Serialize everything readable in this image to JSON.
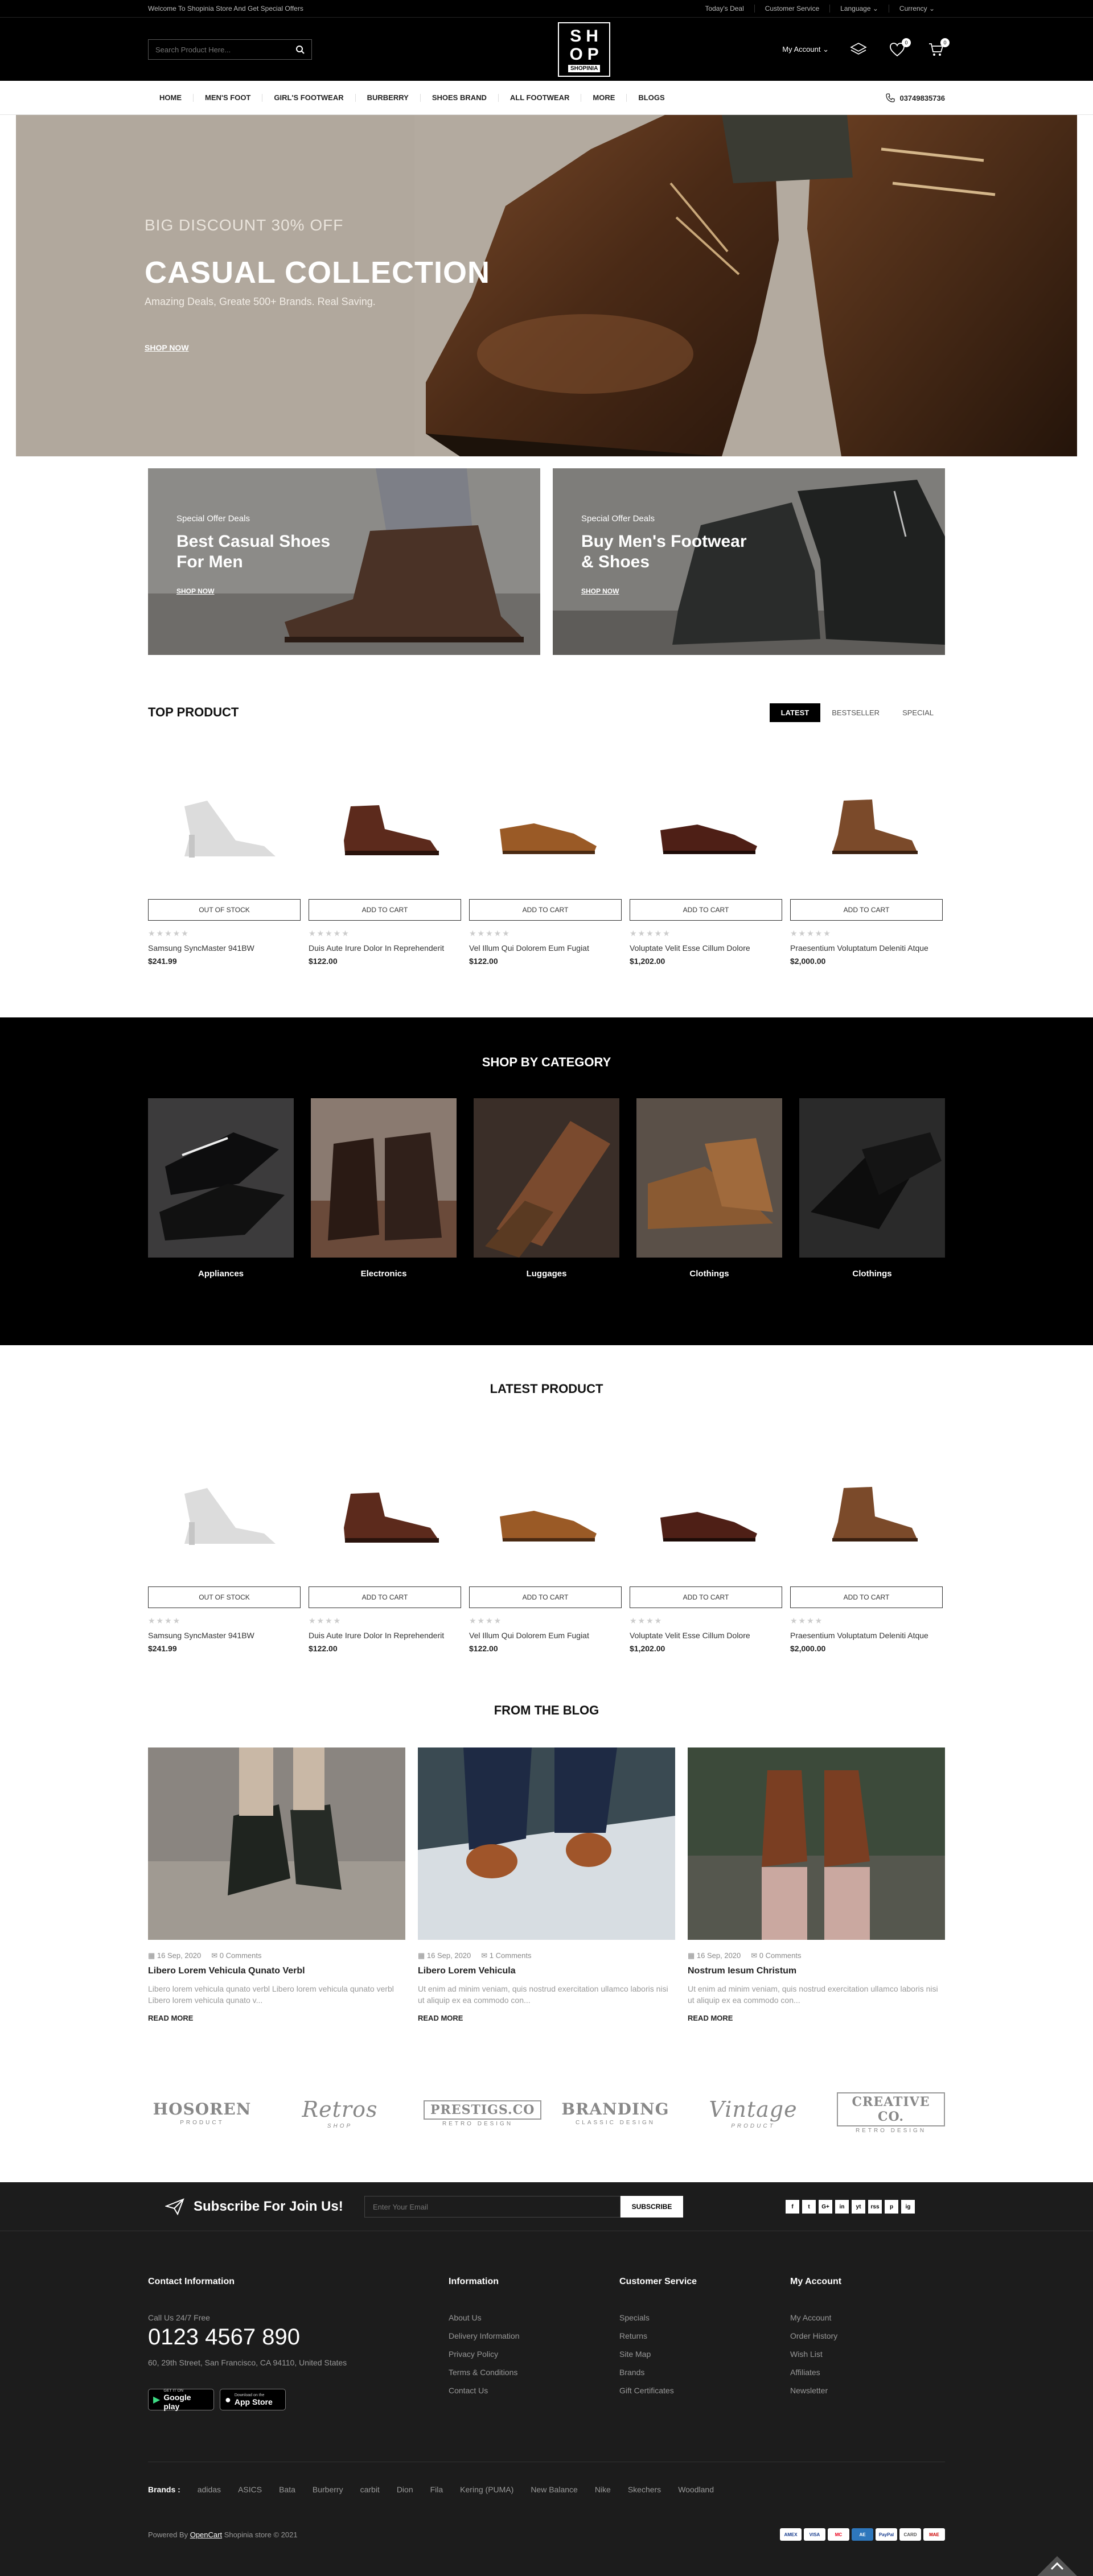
{
  "topbar": {
    "welcome": "Welcome To Shopinia Store And Get Special Offers",
    "links": [
      "Today's Deal",
      "Customer Service",
      "Language",
      "Currency"
    ]
  },
  "header": {
    "search_placeholder": "Search Product Here...",
    "logo_letters": "SHOP",
    "logo_sub": "SHOPINIA",
    "account_label": "My Account",
    "wishlist_count": "0",
    "cart_count": "0"
  },
  "nav": {
    "items": [
      "Home",
      "Men's Foot",
      "Girl's Footwear",
      "Burberry",
      "Shoes Brand",
      "All Footwear",
      "More",
      "Blogs"
    ],
    "phone": "03749835736"
  },
  "hero": {
    "tagline": "BIG DISCOUNT 30% OFF",
    "title": "CASUAL COLLECTION",
    "subtitle": "Amazing Deals, Greate 500+ Brands. Real Saving.",
    "cta": "SHOP NOW"
  },
  "banners": [
    {
      "kicker": "Special Offer Deals",
      "title": "Best Casual Shoes For Men",
      "cta": "SHOP NOW"
    },
    {
      "kicker": "Special Offer Deals",
      "title": "Buy Men's Footwear & Shoes",
      "cta": "SHOP NOW"
    }
  ],
  "top_product": {
    "title": "TOP PRODUCT",
    "tabs": [
      "LATEST",
      "BESTSELLER",
      "SPECIAL"
    ],
    "active_tab": "LATEST",
    "products": [
      {
        "button": "OUT OF STOCK",
        "name": "Samsung SyncMaster 941BW",
        "price": "$241.99"
      },
      {
        "button": "ADD TO CART",
        "name": "Duis Aute Irure Dolor In Reprehenderit",
        "price": "$122.00"
      },
      {
        "button": "ADD TO CART",
        "name": "Vel Illum Qui Dolorem Eum Fugiat",
        "price": "$122.00"
      },
      {
        "button": "ADD TO CART",
        "name": "Voluptate Velit Esse Cillum Dolore",
        "price": "$1,202.00"
      },
      {
        "button": "ADD TO CART",
        "name": "Praesentium Voluptatum Deleniti Atque",
        "price": "$2,000.00"
      }
    ]
  },
  "category": {
    "title": "SHOP BY CATEGORY",
    "items": [
      "Appliances",
      "Electronics",
      "Luggages",
      "Clothings",
      "Clothings"
    ]
  },
  "latest": {
    "title": "LATEST PRODUCT",
    "products": [
      {
        "button": "OUT OF STOCK",
        "name": "Samsung SyncMaster 941BW",
        "price": "$241.99"
      },
      {
        "button": "ADD TO CART",
        "name": "Duis Aute Irure Dolor In Reprehenderit",
        "price": "$122.00"
      },
      {
        "button": "ADD TO CART",
        "name": "Vel Illum Qui Dolorem Eum Fugiat",
        "price": "$122.00"
      },
      {
        "button": "ADD TO CART",
        "name": "Voluptate Velit Esse Cillum Dolore",
        "price": "$1,202.00"
      },
      {
        "button": "ADD TO CART",
        "name": "Praesentium Voluptatum Deleniti Atque",
        "price": "$2,000.00"
      }
    ]
  },
  "blog": {
    "title": "FROM THE BLOG",
    "posts": [
      {
        "date": "16 Sep, 2020",
        "comments": "0 Comments",
        "title": "Libero Lorem Vehicula Qunato Verbl",
        "desc": "Libero lorem vehicula qunato verbl Libero lorem vehicula qunato verbl Libero lorem vehicula qunato v...",
        "more": "READ MORE"
      },
      {
        "date": "16 Sep, 2020",
        "comments": "1 Comments",
        "title": "Libero Lorem Vehicula",
        "desc": "Ut enim ad minim veniam, quis nostrud exercitation ullamco laboris nisi ut aliquip ex ea commodo con...",
        "more": "READ MORE"
      },
      {
        "date": "16 Sep, 2020",
        "comments": "0 Comments",
        "title": "Nostrum Iesum Christum",
        "desc": "Ut enim ad minim veniam, quis nostrud exercitation ullamco laboris nisi ut aliquip ex ea commodo con...",
        "more": "READ MORE"
      }
    ]
  },
  "brands_strip": [
    {
      "name": "HOSOREN",
      "sub": "PRODUCT"
    },
    {
      "name": "Retros",
      "sub": "SHOP"
    },
    {
      "name": "PRESTIGS.CO",
      "sub": "RETRO DESIGN"
    },
    {
      "name": "BRANDING",
      "sub": "CLASSIC DESIGN"
    },
    {
      "name": "Vintage",
      "sub": "PRODUCT"
    },
    {
      "name": "CREATIVE CO.",
      "sub": "RETRO DESIGN"
    }
  ],
  "footer": {
    "subscribe_title": "Subscribe For Join Us!",
    "email_placeholder": "Enter Your Email",
    "subscribe_button": "SUBSCRIBE",
    "socials": [
      "f",
      "t",
      "G+",
      "in",
      "yt",
      "rss",
      "p",
      "ig"
    ],
    "contact": {
      "heading": "Contact Information",
      "label": "Call Us 24/7 Free",
      "phone": "0123 4567 890",
      "address": "60, 29th Street, San Francisco, CA 94110, United States",
      "google_small": "GET IT ON",
      "google_big": "Google play",
      "apple_small": "Download on the",
      "apple_big": "App Store"
    },
    "columns": [
      {
        "heading": "Information",
        "links": [
          "About Us",
          "Delivery Information",
          "Privacy Policy",
          "Terms & Conditions",
          "Contact Us"
        ]
      },
      {
        "heading": "Customer Service",
        "links": [
          "Specials",
          "Returns",
          "Site Map",
          "Brands",
          "Gift Certificates"
        ]
      },
      {
        "heading": "My Account",
        "links": [
          "My Account",
          "Order History",
          "Wish List",
          "Affiliates",
          "Newsletter"
        ]
      }
    ],
    "brands_label": "Brands :",
    "brands": [
      "adidas",
      "ASICS",
      "Bata",
      "Burberry",
      "carbit",
      "Dion",
      "Fila",
      "Kering (PUMA)",
      "New Balance",
      "Nike",
      "Skechers",
      "Woodland"
    ],
    "powered_prefix": "Powered By",
    "powered_link": "OpenCart",
    "powered_suffix": "Shopinia store © 2021",
    "payments": [
      "AMEX",
      "VISA",
      "MC",
      "AE",
      "PayPal",
      "CARD",
      "MAE"
    ]
  },
  "colors": {
    "black": "#000000",
    "footer_bg": "#1c1c1c",
    "hero_bg": "#b1a89d"
  }
}
